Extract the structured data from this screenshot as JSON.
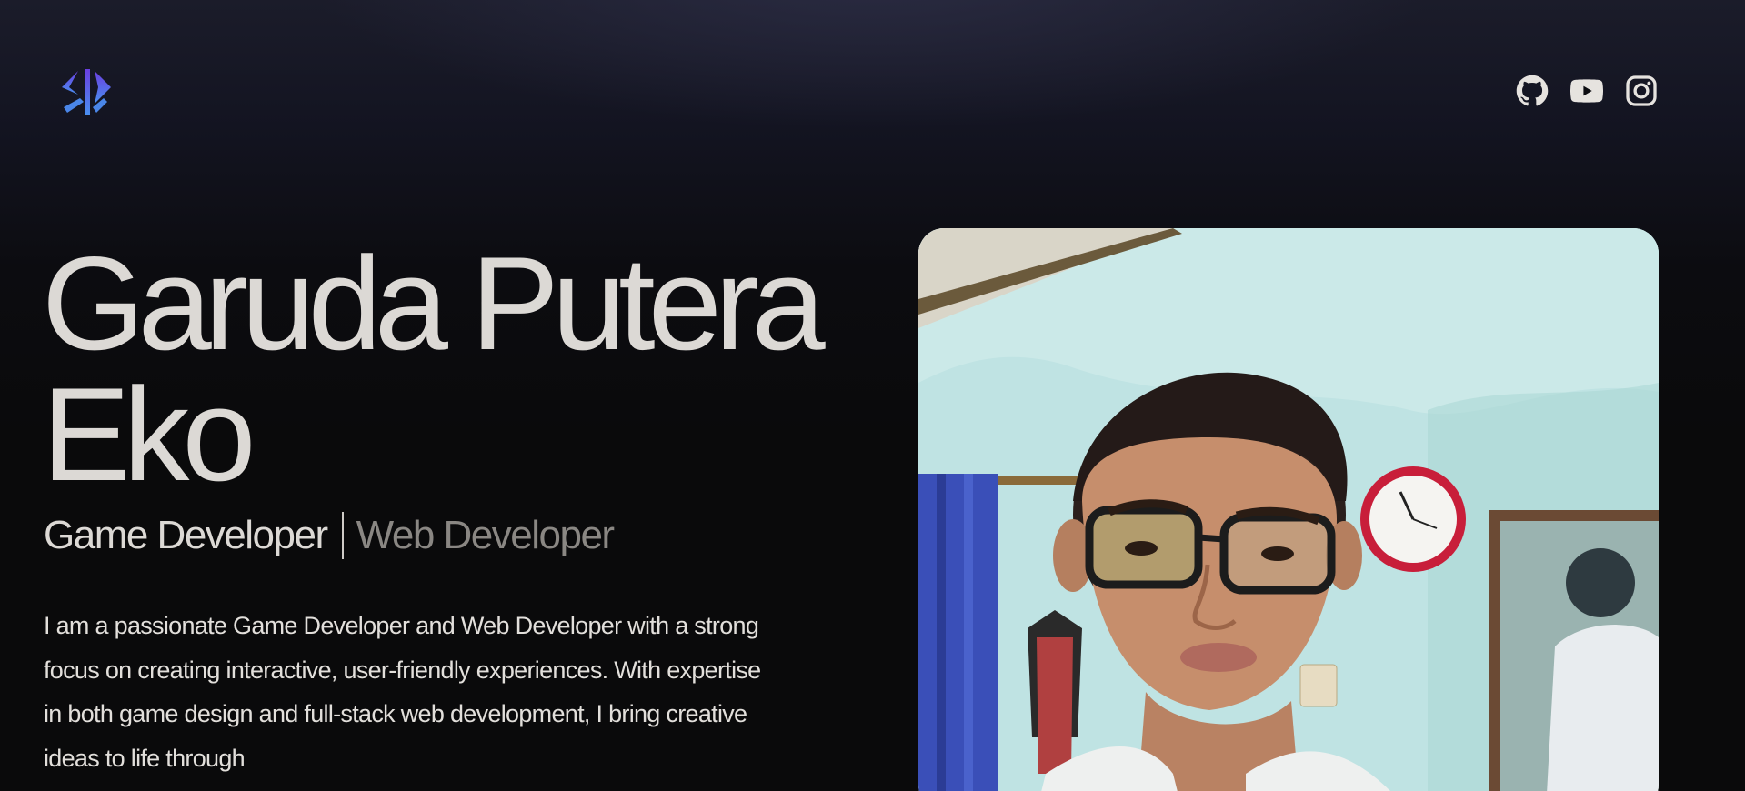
{
  "header": {
    "logo_icon": "brand-logo-icon",
    "socials": [
      {
        "name": "github",
        "icon": "github-icon"
      },
      {
        "name": "youtube",
        "icon": "youtube-icon"
      },
      {
        "name": "instagram",
        "icon": "instagram-icon"
      }
    ]
  },
  "hero": {
    "name_line1": "Garuda Putera",
    "name_line2": "Eko",
    "role_primary": "Game Developer",
    "role_secondary": "Web Developer",
    "bio": "I am a passionate Game Developer and Web Developer with a strong focus on creating interactive, user-friendly experiences. With expertise in both game design and full-stack web development, I bring creative ideas to life through"
  },
  "colors": {
    "background": "#0a0a0b",
    "text": "#dcd9d5",
    "muted": "#8a8783",
    "logo_purple": "#5a3fd6",
    "logo_blue": "#4a86e8"
  }
}
